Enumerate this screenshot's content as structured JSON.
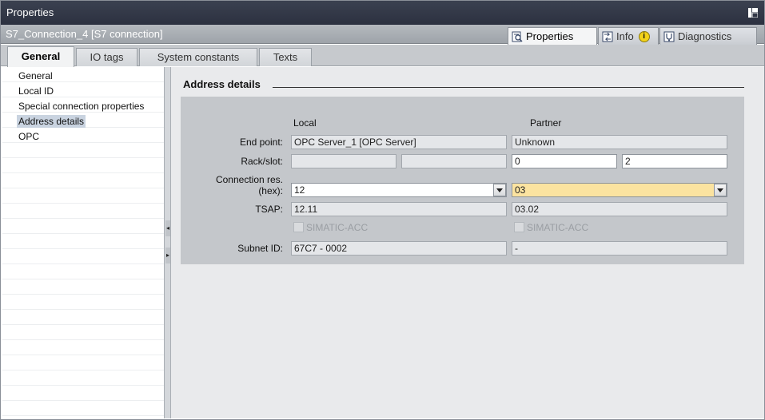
{
  "window": {
    "title": "Properties"
  },
  "object": {
    "name": "S7_Connection_4 [S7 connection]"
  },
  "right_tabs": [
    {
      "label": "Properties",
      "icon": "properties-icon",
      "active": true
    },
    {
      "label": "Info",
      "icon": "info-icon",
      "badge": "i"
    },
    {
      "label": "Diagnostics",
      "icon": "diagnostics-icon"
    }
  ],
  "left_tabs": [
    {
      "label": "General",
      "active": true
    },
    {
      "label": "IO tags"
    },
    {
      "label": "System constants"
    },
    {
      "label": "Texts"
    }
  ],
  "nav": {
    "items": [
      {
        "label": "General"
      },
      {
        "label": "Local ID"
      },
      {
        "label": "Special connection properties"
      },
      {
        "label": "Address details",
        "selected": true
      },
      {
        "label": "OPC"
      }
    ]
  },
  "section": {
    "title": "Address details",
    "col_local": "Local",
    "col_partner": "Partner",
    "end_point": {
      "label": "End point:",
      "local": "OPC Server_1 [OPC Server]",
      "partner": "Unknown"
    },
    "rack_slot": {
      "label": "Rack/slot:",
      "local_rack": "",
      "local_slot": "",
      "partner_rack": "0",
      "partner_slot": "2"
    },
    "conn_res": {
      "label_line1": "Connection res.",
      "label_line2": "(hex):",
      "local": "12",
      "partner": "03"
    },
    "tsap": {
      "label": "TSAP:",
      "local": "12.11",
      "partner": "03.02"
    },
    "simatic_acc": {
      "local": "SIMATIC-ACC",
      "partner": "SIMATIC-ACC"
    },
    "subnet_id": {
      "label": "Subnet ID:",
      "local": "67C7 - 0002",
      "partner": "-"
    }
  },
  "colors": {
    "titlebar": "#2c3140",
    "highlight": "#fbe3a0",
    "selection": "#c9d3e0"
  }
}
